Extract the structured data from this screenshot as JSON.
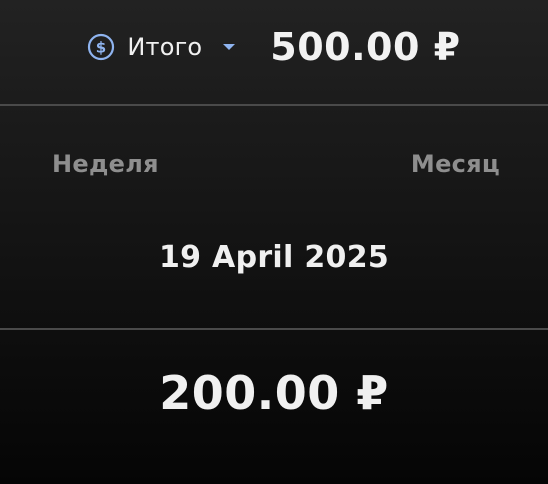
{
  "header": {
    "selector_label": "Итого",
    "selector_icon": "dollar-circle-icon",
    "dropdown_icon": "chevron-down-icon",
    "accent_color": "#8fb4f0",
    "total_amount": "500.00 ₽"
  },
  "period_tabs": {
    "week_label": "Неделя",
    "month_label": "Месяц"
  },
  "date": "19 April 2025",
  "period_amount": "200.00 ₽"
}
